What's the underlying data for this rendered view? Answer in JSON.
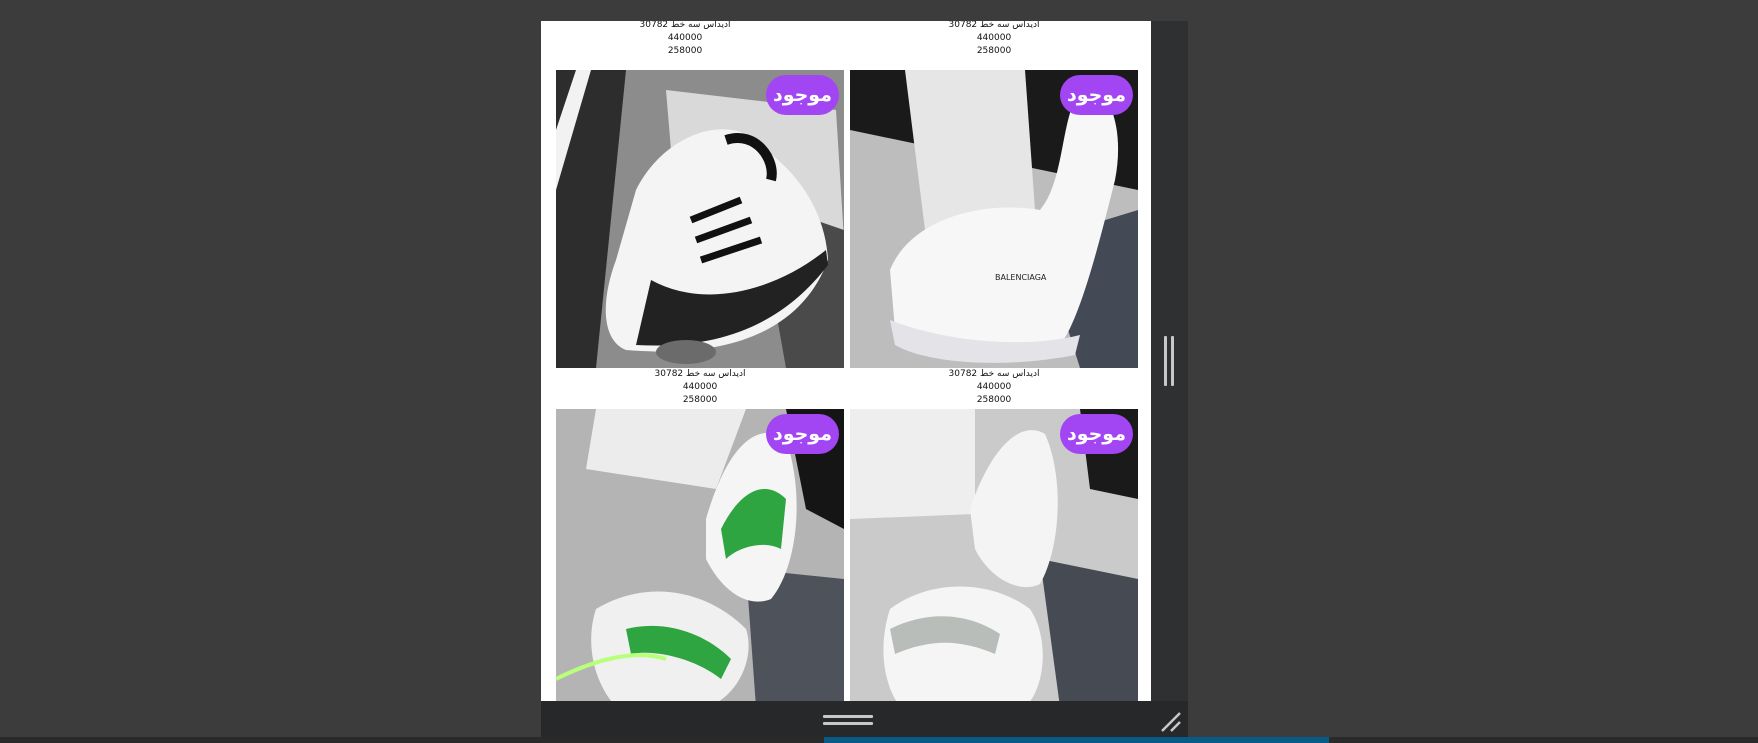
{
  "products": [
    {
      "title": "ادیداس سه خط 30782",
      "price": "440000",
      "sale_price": "258000",
      "badge": ""
    },
    {
      "title": "ادیداس سه خط 30782",
      "price": "440000",
      "sale_price": "258000",
      "badge": ""
    },
    {
      "title": "ادیداس سه خط 30782",
      "price": "440000",
      "sale_price": "258000",
      "badge": "موجود",
      "image": "white-black-stripe-sneaker"
    },
    {
      "title": "ادیداس سه خط 30782",
      "price": "440000",
      "sale_price": "258000",
      "badge": "موجود",
      "image": "white-balenciaga-sneaker"
    },
    {
      "title": "",
      "price": "",
      "sale_price": "",
      "badge": "موجود",
      "image": "white-green-sneakers"
    },
    {
      "title": "",
      "price": "",
      "sale_price": "",
      "badge": "موجود",
      "image": "white-grey-fashion-sneaker"
    }
  ],
  "colors": {
    "badge": "#a245f2",
    "background": "#3c3c3c",
    "viewer_chrome": "#272829",
    "taskbar_active": "#0a5a86"
  },
  "icons": {
    "scroll_grip": "vertical-grip-icon",
    "drag_handle": "horizontal-grip-icon",
    "resize": "resize-corner-icon"
  }
}
